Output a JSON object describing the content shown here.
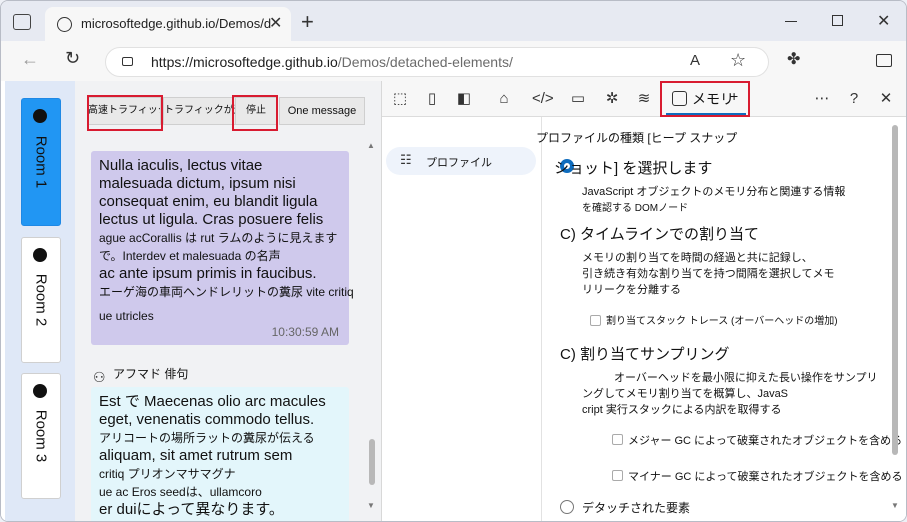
{
  "browser": {
    "tab_title": "microsoftedge.github.io/Demos/d",
    "new_tab": "+",
    "url_host": "https://microsoftedge.github.io",
    "url_path": "/Demos/detached-elements/",
    "icons": [
      "globe-icon",
      "close-icon",
      "back-icon",
      "refresh-icon",
      "lock-icon",
      "read-aloud-icon",
      "favorite-icon",
      "extensions-icon",
      "sidebar-icon",
      "minimize-icon",
      "maximize-icon",
      "close-window-icon"
    ]
  },
  "rooms": [
    {
      "label": "Room 1",
      "active": true
    },
    {
      "label": "Room 2",
      "active": false
    },
    {
      "label": "Room 3",
      "active": false
    }
  ],
  "chat": {
    "toolbar": [
      "高速トラフィック",
      "トラフィックが遅い",
      "停止",
      "One message"
    ],
    "messages": [
      {
        "lines": [
          {
            "t": "Nulla iaculis, lectus vitae",
            "s": false
          },
          {
            "t": "malesuada dictum, ipsum nisi",
            "s": false
          },
          {
            "t": "consequat enim, eu blandit ligula",
            "s": false
          },
          {
            "t": "lectus ut ligula. Cras posuere felis",
            "s": false
          },
          {
            "t": "ague acCorallis は rut ラムのように見えます",
            "s": true
          },
          {
            "t": "で。Interdev et malesuada の名声",
            "s": true
          },
          {
            "t": "ac ante ipsum primis in faucibus.",
            "s": false
          },
          {
            "t": "エーゲ海の車両ヘンドレリットの糞尿 vite critiq",
            "s": true
          },
          {
            "t": "ue utricles",
            "s": true
          }
        ],
        "time": "10:30:59 AM"
      },
      {
        "author": "アフマド 俳句",
        "lines": [
          {
            "t": "Est で Maecenas olio arc macules",
            "s": false
          },
          {
            "t": "eget, venenatis commodo tellus.",
            "s": false
          },
          {
            "t": "アリコートの場所ラットの糞尿が伝える",
            "s": true
          },
          {
            "t": "aliquam, sit amet rutrum sem",
            "s": false
          },
          {
            "t": "critiq プリオンマサマグナ",
            "s": true
          },
          {
            "t": "ue ac Eros seedは、ullamcoro",
            "s": true
          },
          {
            "t": "er duiによって異なります。",
            "s": false
          }
        ]
      }
    ]
  },
  "devtools": {
    "tab_label": "メモリ",
    "add": "+",
    "sidebar_item": "プロファイル",
    "heading": "プロファイルの種類 [ヒープ スナップ",
    "options": [
      {
        "title": "ショット] を選択します",
        "desc": [
          "JavaScript オブジェクトのメモリ分布と関連する情報",
          "を確認する DOMノード"
        ],
        "checks": []
      },
      {
        "title": "C) タイムラインでの割り当て",
        "desc": [
          "メモリの割り当てを時間の経過と共に記録し、",
          "引き続き有効な割り当てを持つ間隔を選択してメモ",
          "リリークを分離する"
        ],
        "checks": [
          "割り当てスタック トレース (オーバーヘッドの増加)"
        ]
      },
      {
        "title": "C) 割り当てサンプリング",
        "desc": [
          "オーバーヘッドを最小限に抑えた長い操作をサンプリ",
          "ングしてメモリ割り当てを概算し、JavaS",
          "cript 実行スタックによる内訳を取得する"
        ],
        "checks": [
          "メジャー GC によって破棄されたオブジェクトを含める",
          "マイナー GC によって破棄されたオブジェクトを含める"
        ]
      },
      {
        "title": "デタッチされた要素",
        "desc": [],
        "checks": []
      }
    ]
  }
}
